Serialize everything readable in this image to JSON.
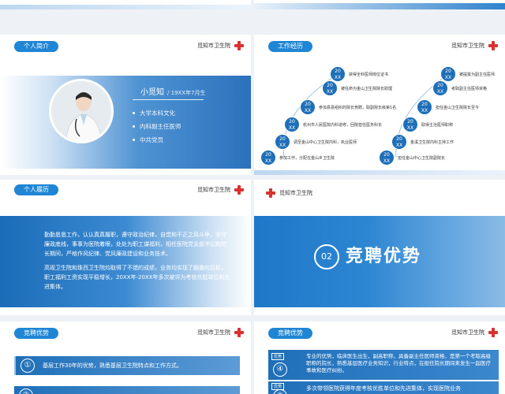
{
  "hospital_name": "觅知市卫生院",
  "profile": {
    "tag": "个人简介",
    "name": "小觅知",
    "birth": "/ 19XX年7月生",
    "bullets": [
      "大学本科文化",
      "内科副主任医师",
      "中共党员"
    ]
  },
  "experience": {
    "tag": "工作经历",
    "year_label": [
      "20",
      "XX"
    ],
    "left_items": [
      "获得全科医师岗位证书",
      "被任命为金山卫生院院长助理",
      "参加县县组织的院长竞聘，取副院长级第1名",
      "杭州市人民医院内科进修，回院担任医务科长",
      "调至金山中心卫生院内科，执业医师",
      "参加工作，分配在金山乡卫生院"
    ],
    "right_items": [
      "被提拔为副主任医师",
      "考取副主任医师资格",
      "担任金山卫生院院长至今",
      "取得主治医师职称",
      "金溪卫生院内科主持工作",
      "担任金山中心卫生院副院长"
    ]
  },
  "resume": {
    "tag": "个人履历",
    "paragraphs": [
      "勤勤恳恳工作，认认真真履职，遵守政治纪律，自觉和不正之风斗争，坚守廉政底线，事事为医院着眼，处处为职工谋福利，相任医院党支部书记和院长期间，严格作风纪律、党风廉政建设和业务技术。",
      "高视卫生院和珠西卫生院均取得了不错的成绩，业务均实现了翻番的目标，职工福利工资实现平稳增长，20XX年-20XX年多次被评为考核优胜单位和先进集体。"
    ]
  },
  "section": {
    "number": "02",
    "title": "竞聘优势"
  },
  "advantages_left": {
    "tag": "竞聘优势",
    "items": [
      {
        "num": "①",
        "text": "基层工作30年的优势，熟悉基层卫生院特点和工作方式。"
      },
      {
        "num": "②",
        "text": ""
      }
    ]
  },
  "advantages_right": {
    "tag": "竞聘优势",
    "items": [
      {
        "badge": "优势",
        "num": "④",
        "text": "专业的优势，临床医生出生，副高职称，具备副主任医师资格，是第一个考取高级职称的院长，熟悉基层医疗业务知识，行业特点，在担任院长期间来发生一起医疗事故和医疗纠纷。"
      },
      {
        "badge": "优势",
        "num": "⑤",
        "text": "多次带领医院获得年度考核优胜单位和先进集体，实现医院业务"
      }
    ]
  },
  "colors": {
    "accent": "#1f86d6",
    "dark_blue": "#1a5fa8",
    "red": "#d9322f"
  }
}
